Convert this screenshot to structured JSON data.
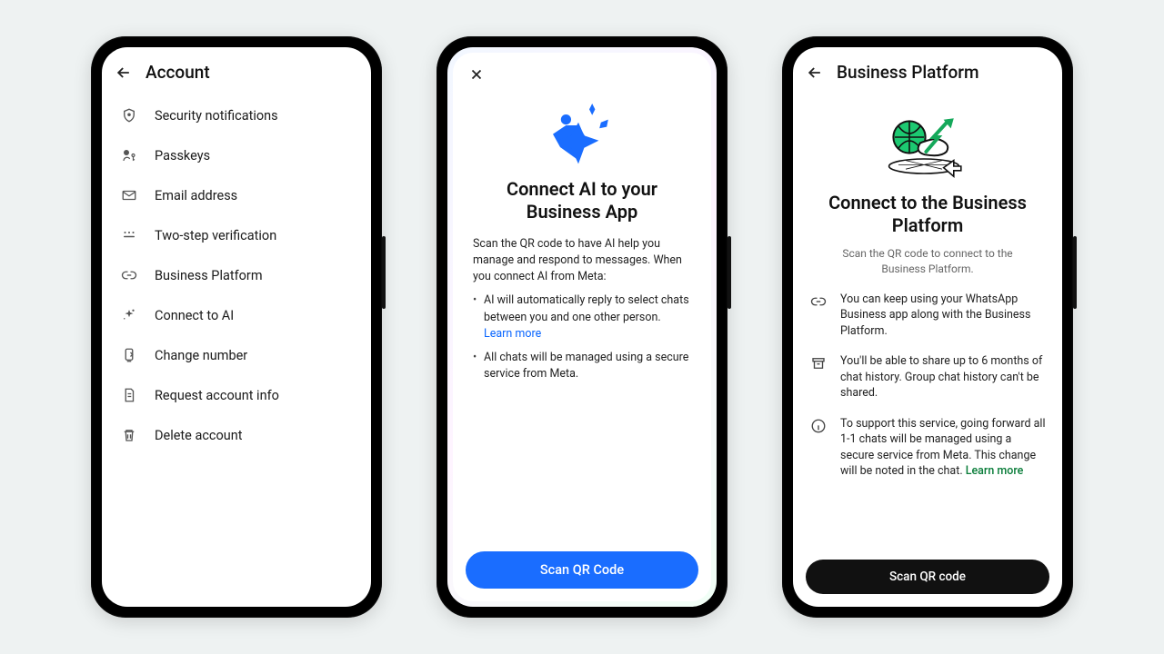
{
  "phone1": {
    "title": "Account",
    "items": [
      {
        "label": "Security notifications"
      },
      {
        "label": "Passkeys"
      },
      {
        "label": "Email address"
      },
      {
        "label": "Two-step verification"
      },
      {
        "label": "Business Platform"
      },
      {
        "label": "Connect to AI"
      },
      {
        "label": "Change number"
      },
      {
        "label": "Request account info"
      },
      {
        "label": "Delete account"
      }
    ]
  },
  "phone2": {
    "title": "Connect AI to your Business App",
    "lead": "Scan the QR code to have AI help you manage and respond to messages. When you connect AI from Meta:",
    "bullet1_a": "AI will automatically reply to select chats between you and one other person. ",
    "bullet1_link": "Learn more",
    "bullet2": "All chats will be managed using a secure service from Meta.",
    "button": "Scan QR Code"
  },
  "phone3": {
    "title": "Business Platform",
    "heading": "Connect to the Business Platform",
    "sub": "Scan the QR code to connect to the Business Platform.",
    "info1": "You can keep using your WhatsApp Business app along with the Business Platform.",
    "info2": "You'll be able to share up to 6 months of chat history. Group chat history can't be shared.",
    "info3_a": "To support this service, going forward all 1-1 chats will be managed using a secure service from Meta. This change will be noted in the chat. ",
    "info3_link": "Learn more",
    "button": "Scan QR code"
  }
}
